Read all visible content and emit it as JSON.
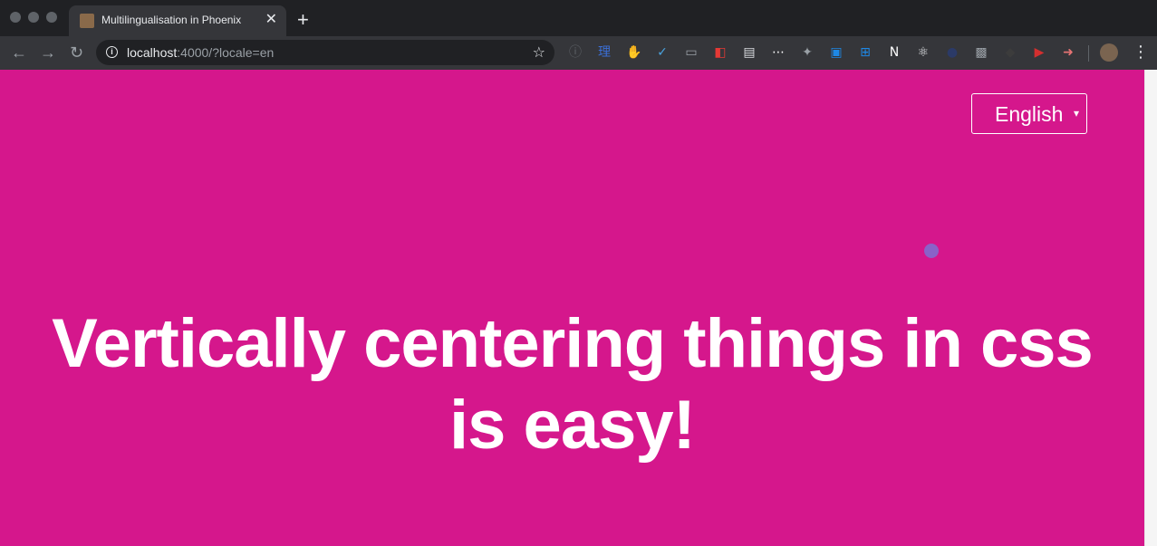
{
  "browser": {
    "tab": {
      "title": "Multilingualisation in Phoenix",
      "close_glyph": "✕",
      "favicon": "phoenix-favicon"
    },
    "new_tab_glyph": "+",
    "nav": {
      "back_glyph": "←",
      "forward_glyph": "→",
      "reload_glyph": "↻"
    },
    "address_bar": {
      "host": "localhost",
      "rest": ":4000/?locale=en",
      "info_glyph": "i",
      "star_glyph": "☆"
    },
    "extensions": [
      {
        "name": "info-circle-extension-icon",
        "glyph": "ⓘ",
        "color": "#5f6368"
      },
      {
        "name": "chinese-dictionary-extension-icon",
        "glyph": "理",
        "color": "#3b6fd6"
      },
      {
        "name": "adblock-extension-icon",
        "glyph": "✋",
        "color": "#d32f2f"
      },
      {
        "name": "vue-devtools-extension-icon",
        "glyph": "✓",
        "color": "#4aa3df"
      },
      {
        "name": "chat-extension-icon",
        "glyph": "▭",
        "color": "#9aa0a6"
      },
      {
        "name": "redux-extension-icon",
        "glyph": "◧",
        "color": "#e53935"
      },
      {
        "name": "document-extension-icon",
        "glyph": "▤",
        "color": "#dadce0"
      },
      {
        "name": "ellipsis-extension-icon",
        "glyph": "⋯",
        "color": "#ffffff"
      },
      {
        "name": "puzzle-extension-icon",
        "glyph": "✦",
        "color": "#9aa0a6"
      },
      {
        "name": "translate-extension-icon",
        "glyph": "▣",
        "color": "#1e88e5"
      },
      {
        "name": "grid-extension-icon",
        "glyph": "⊞",
        "color": "#1e88e5"
      },
      {
        "name": "notion-extension-icon",
        "glyph": "N",
        "color": "#ffffff"
      },
      {
        "name": "react-devtools-extension-icon",
        "glyph": "⚛",
        "color": "#e8eaed"
      },
      {
        "name": "dark-circle-extension-icon",
        "glyph": "●",
        "color": "#2b3a67"
      },
      {
        "name": "briefcase-extension-icon",
        "glyph": "▩",
        "color": "#9aa0a6"
      },
      {
        "name": "dark-extension-icon",
        "glyph": "◆",
        "color": "#3c3c3c"
      },
      {
        "name": "youtube-extension-icon",
        "glyph": "▶",
        "color": "#d32f2f"
      },
      {
        "name": "arrow-extension-icon",
        "glyph": "➜",
        "color": "#e57373"
      }
    ],
    "menu_glyph": "⋮"
  },
  "page": {
    "background": "#d5178c",
    "language_select": {
      "selected": "English",
      "arrow": "▾"
    },
    "headline_line1": "Vertically centering things in css",
    "headline_line2": "is easy!"
  }
}
